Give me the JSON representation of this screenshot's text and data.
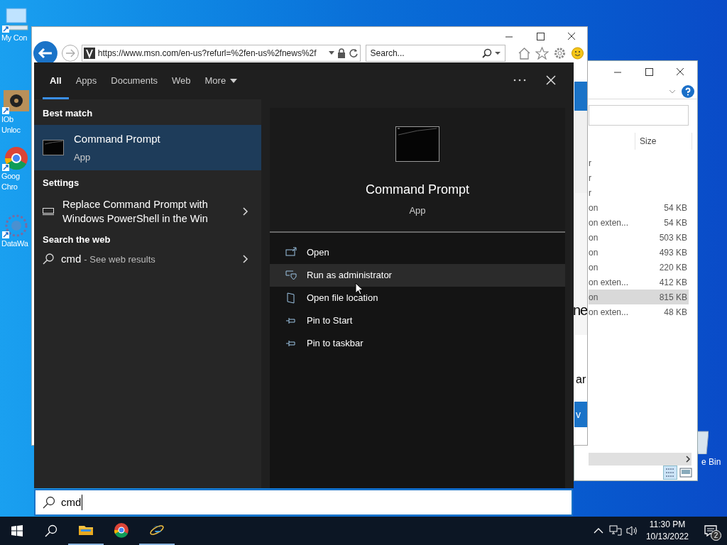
{
  "desktop": {
    "icons": [
      {
        "kind": "computer",
        "lines": [
          "My Con"
        ]
      },
      {
        "kind": "gear",
        "lines": [
          "IOb",
          "Unloc"
        ]
      },
      {
        "kind": "chrome",
        "lines": [
          "Goog",
          "Chro"
        ]
      },
      {
        "kind": "network",
        "lines": [
          "DataWa"
        ]
      }
    ],
    "recycle_bin": {
      "label": "e Bin"
    }
  },
  "browser": {
    "address": "https://www.msn.com/en-us?refurl=%2fen-us%2fnews%2f",
    "search_placeholder": "Search...",
    "page_fragments": [
      {
        "kind": "heading",
        "text": "ne"
      },
      {
        "kind": "text",
        "text": "ar"
      },
      {
        "kind": "button",
        "text": "v"
      }
    ]
  },
  "explorer": {
    "column": "Size",
    "rows": [
      {
        "type": "r",
        "selected": false
      },
      {
        "type": "r",
        "selected": false
      },
      {
        "type": "r",
        "selected": false
      },
      {
        "type": "on",
        "size": "54 KB",
        "selected": false
      },
      {
        "type": "on exten...",
        "size": "54 KB",
        "selected": false
      },
      {
        "type": "on",
        "size": "503 KB",
        "selected": false
      },
      {
        "type": "on",
        "size": "493 KB",
        "selected": false
      },
      {
        "type": "on",
        "size": "220 KB",
        "selected": false
      },
      {
        "type": "on exten...",
        "size": "412 KB",
        "selected": false
      },
      {
        "type": "on",
        "size": "815 KB",
        "selected": true
      },
      {
        "type": "on exten...",
        "size": "48 KB",
        "selected": false
      }
    ]
  },
  "search": {
    "tabs": [
      {
        "label": "All",
        "selected": true
      },
      {
        "label": "Apps",
        "selected": false
      },
      {
        "label": "Documents",
        "selected": false
      },
      {
        "label": "Web",
        "selected": false
      },
      {
        "label": "More",
        "selected": false,
        "dropdown": true
      }
    ],
    "sections": [
      {
        "heading": "Best match",
        "items": [
          {
            "kind": "app",
            "title": "Command Prompt",
            "subtitle": "App",
            "selected": true
          }
        ]
      },
      {
        "heading": "Settings",
        "items": [
          {
            "kind": "setting",
            "lines": [
              "Replace Command Prompt with",
              "Windows PowerShell in the Win"
            ],
            "selected": false
          }
        ]
      },
      {
        "heading": "Search the web",
        "items": [
          {
            "kind": "web",
            "query": "cmd",
            "suffix": "- See web results",
            "selected": false
          }
        ]
      }
    ],
    "preview": {
      "title": "Command Prompt",
      "subtitle": "App",
      "actions": [
        {
          "kind": "open",
          "label": "Open",
          "hovered": false
        },
        {
          "kind": "admin",
          "label": "Run as administrator",
          "hovered": true
        },
        {
          "kind": "location",
          "label": "Open file location",
          "hovered": false
        },
        {
          "kind": "pin",
          "label": "Pin to Start",
          "hovered": false
        },
        {
          "kind": "pin",
          "label": "Pin to taskbar",
          "hovered": false
        }
      ]
    },
    "query": "cmd"
  },
  "taskbar": {
    "apps": [
      {
        "kind": "explorer",
        "running": true
      },
      {
        "kind": "chrome",
        "running": false
      },
      {
        "kind": "ie",
        "running": true
      }
    ],
    "time": "11:30 PM",
    "date": "10/13/2022",
    "notifications": "2"
  }
}
